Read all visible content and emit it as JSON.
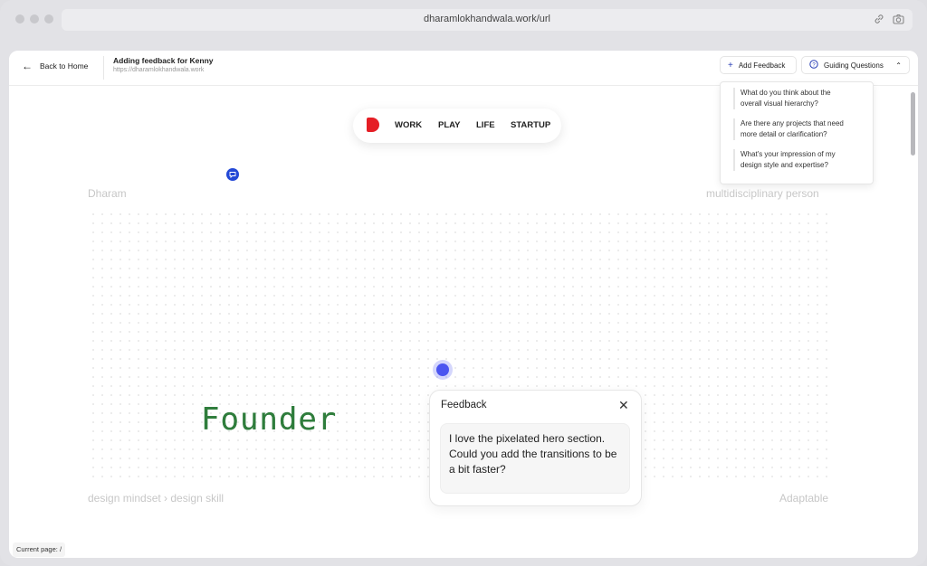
{
  "browser": {
    "url": "dharamlokhandwala.work/url",
    "link_icon": "link-icon",
    "camera_icon": "camera-icon"
  },
  "toolbar": {
    "back_label": "Back to Home",
    "page_title": "Adding feedback for Kenny",
    "page_url": "https://dharamlokhandwala.work",
    "add_feedback_label": "Add Feedback",
    "guiding_questions_label": "Guiding Questions"
  },
  "guiding_questions": [
    {
      "line1": "What do you think about the",
      "line2": "overall visual hierarchy?"
    },
    {
      "line1": "Are there any projects that need",
      "line2": "more detail or clarification?"
    },
    {
      "line1": "What's your impression of my",
      "line2": "design style and expertise?"
    }
  ],
  "nav": {
    "items": [
      "WORK",
      "PLAY",
      "LIFE",
      "STARTUP"
    ],
    "logo_color": "#e51e25"
  },
  "hero": {
    "top_left": "Dharam",
    "top_right": "multidisciplinary person",
    "bottom_left": "design mindset › design skill",
    "bottom_right": "Adaptable",
    "center_word": "Founder"
  },
  "feedback": {
    "title": "Feedback",
    "text": "I love the pixelated hero section. Could you add the transitions to be a bit faster?"
  },
  "status": {
    "current_page": "Current page: /"
  },
  "colors": {
    "accent": "#4b55f0",
    "pin": "#2348d6",
    "founder": "#2f7d3c"
  }
}
